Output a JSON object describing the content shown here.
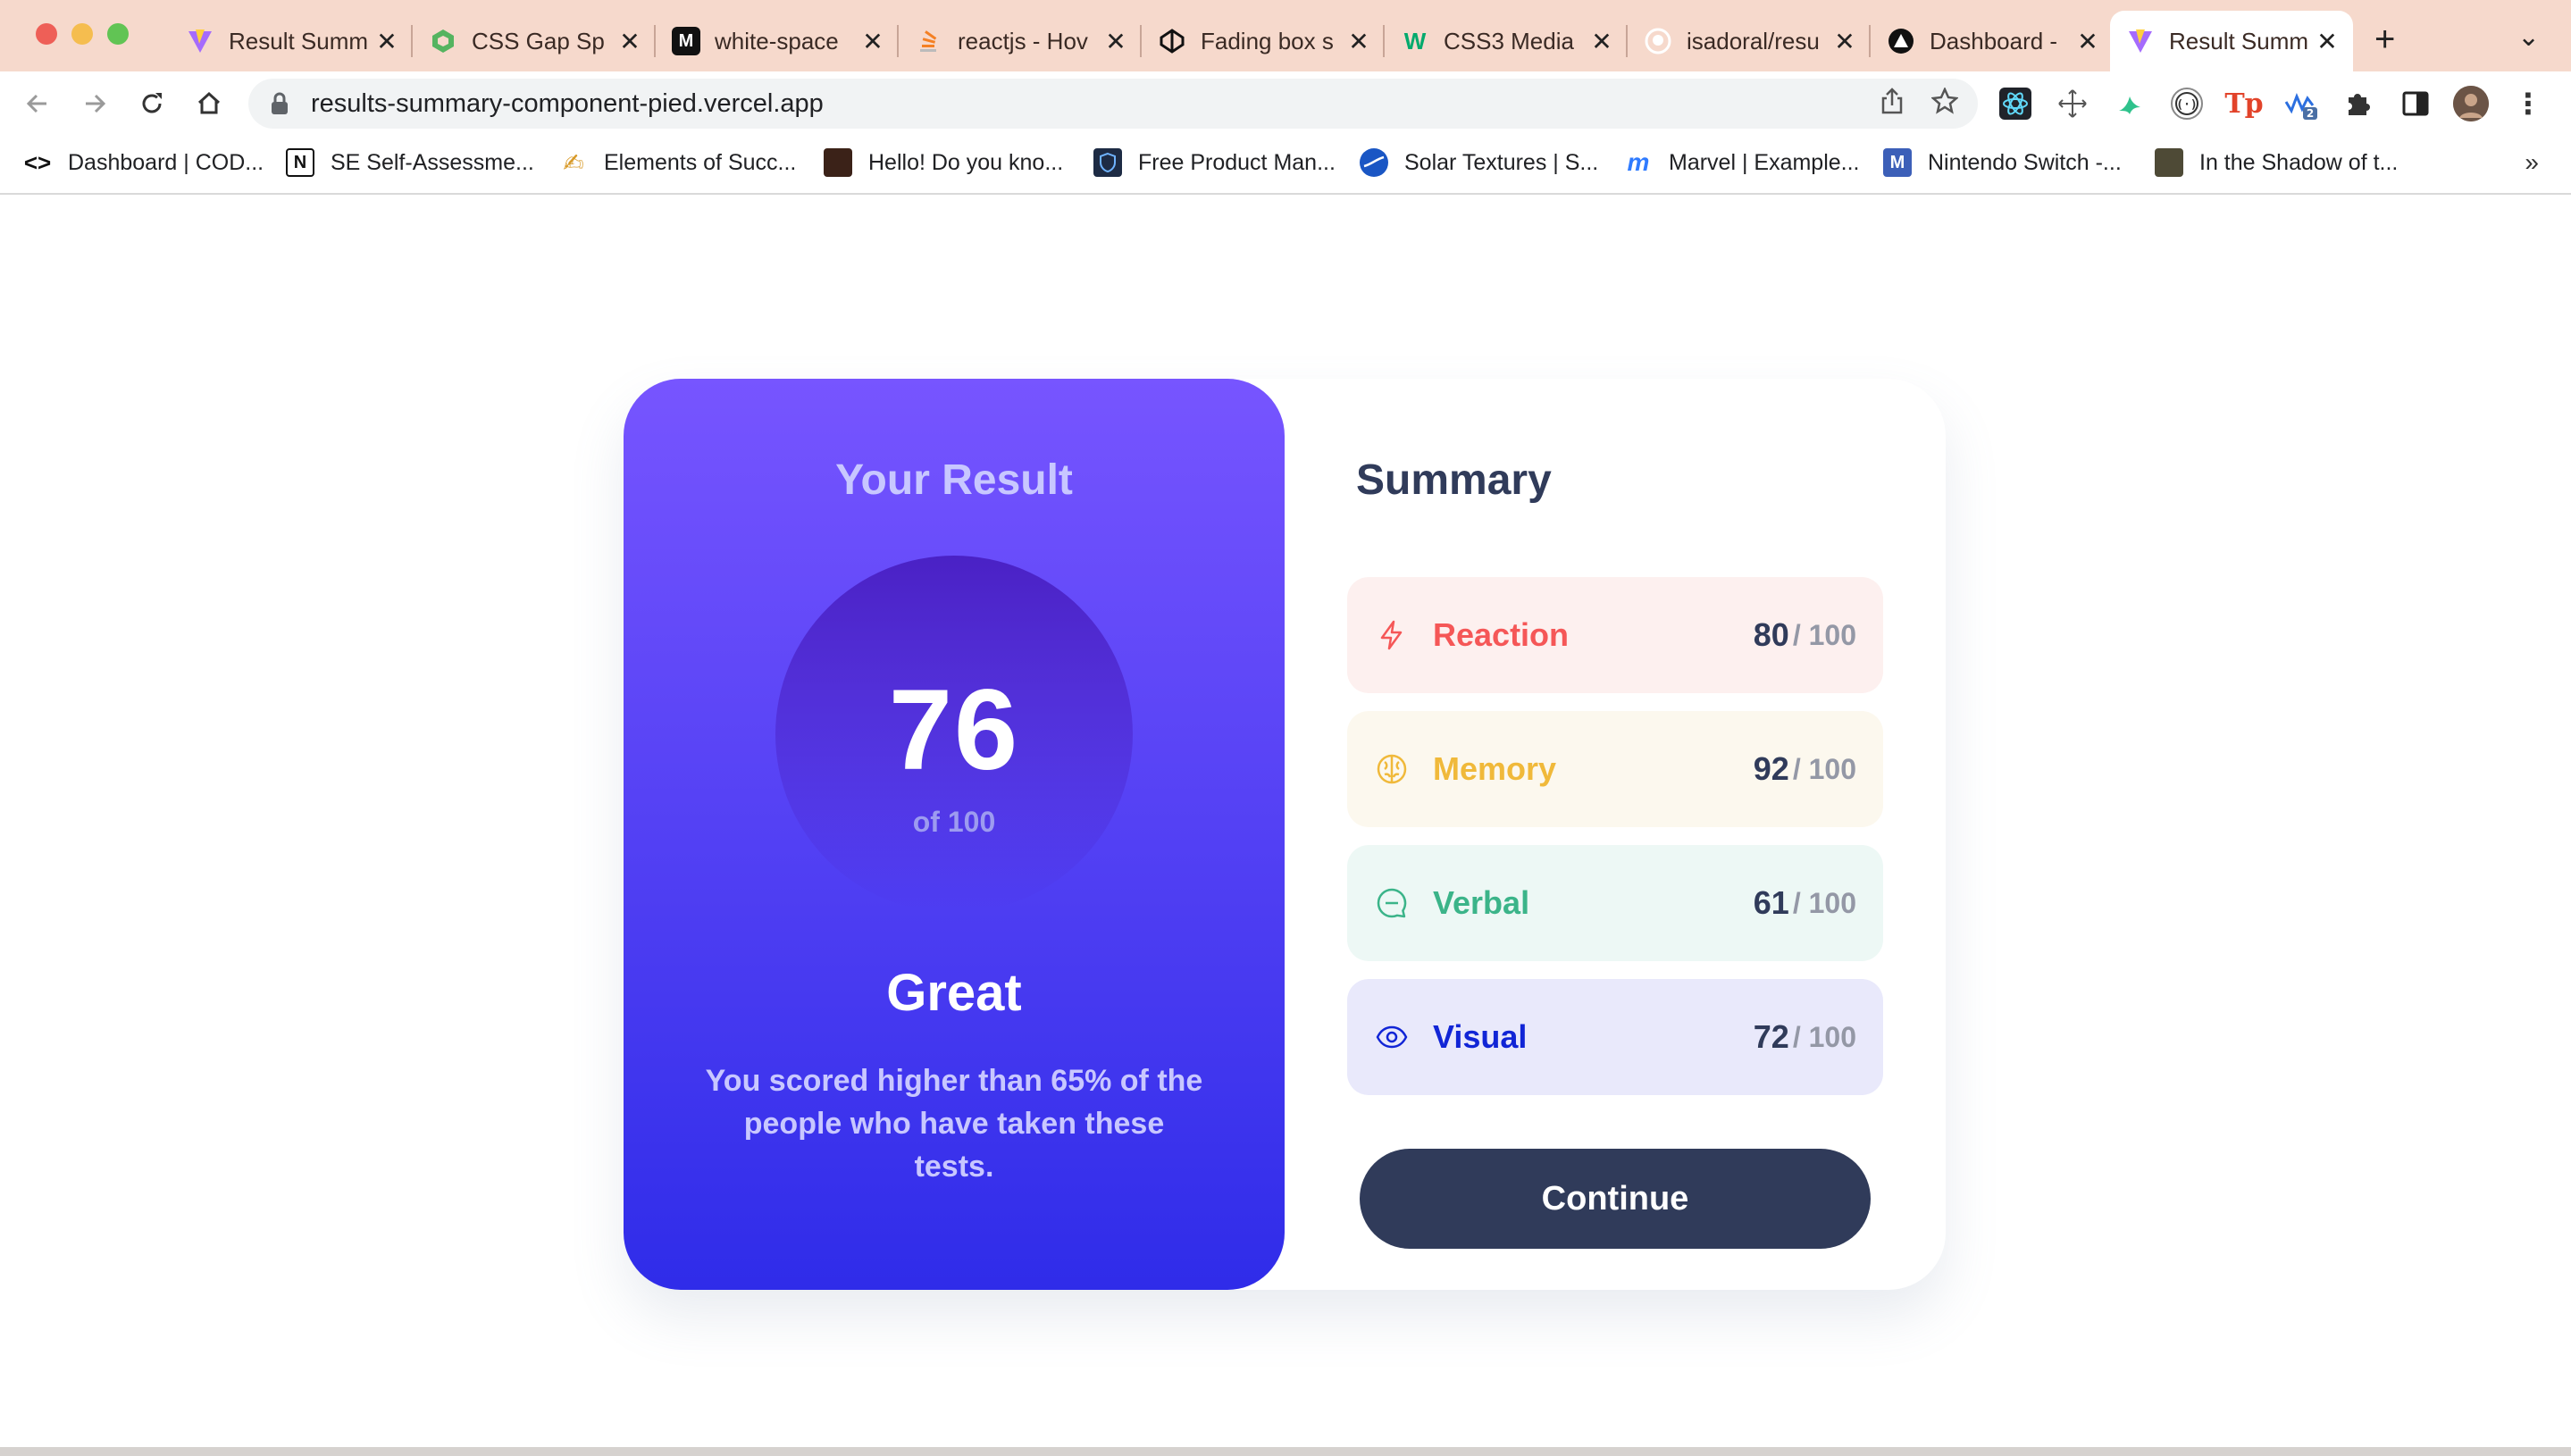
{
  "browser": {
    "tabs": [
      {
        "title": "Result Summ",
        "active": false,
        "favicon": "vite-icon"
      },
      {
        "title": "CSS Gap Sp",
        "active": false,
        "favicon": "hexagon-icon"
      },
      {
        "title": "white-space",
        "active": false,
        "favicon": "mdn-icon"
      },
      {
        "title": "reactjs - Hov",
        "active": false,
        "favicon": "stackoverflow-icon"
      },
      {
        "title": "Fading box s",
        "active": false,
        "favicon": "codepen-icon"
      },
      {
        "title": "CSS3 Media",
        "active": false,
        "favicon": "w3schools-icon"
      },
      {
        "title": "isadoral/resu",
        "active": false,
        "favicon": "github-icon"
      },
      {
        "title": "Dashboard -",
        "active": false,
        "favicon": "triangle-icon"
      },
      {
        "title": "Result Summ",
        "active": true,
        "favicon": "vite-icon"
      }
    ],
    "new_tab_label": "+",
    "url": "results-summary-component-pied.vercel.app",
    "bookmarks": [
      {
        "label": "Dashboard | COD...",
        "icon": "code-icon"
      },
      {
        "label": "SE Self-Assessme...",
        "icon": "notion-icon"
      },
      {
        "label": "Elements of Succ...",
        "icon": "pencil-icon"
      },
      {
        "label": "Hello! Do you kno...",
        "icon": "book-icon"
      },
      {
        "label": "Free Product Man...",
        "icon": "shield-icon"
      },
      {
        "label": "Solar Textures | S...",
        "icon": "planet-icon"
      },
      {
        "label": "Marvel | Example...",
        "icon": "marvel-icon"
      },
      {
        "label": "Nintendo Switch -...",
        "icon": "m-icon"
      },
      {
        "label": "In the Shadow of t...",
        "icon": "photo-icon"
      }
    ],
    "bookmarks_more": "»",
    "extension_badge": "2"
  },
  "result": {
    "heading": "Your Result",
    "score": "76",
    "score_total": "of 100",
    "grade": "Great",
    "description": "You scored higher than 65% of the people who have taken these tests."
  },
  "summary": {
    "title": "Summary",
    "categories": [
      {
        "label": "Reaction",
        "score": "80",
        "max": "/ 100",
        "color": "#f55757",
        "bg": "#fdf0ef",
        "icon": "lightning-icon"
      },
      {
        "label": "Memory",
        "score": "92",
        "max": "/ 100",
        "color": "#f0b93a",
        "bg": "#fcf8ee",
        "icon": "brain-icon"
      },
      {
        "label": "Verbal",
        "score": "61",
        "max": "/ 100",
        "color": "#3bb489",
        "bg": "#edf8f5",
        "icon": "chat-icon"
      },
      {
        "label": "Visual",
        "score": "72",
        "max": "/ 100",
        "color": "#1125d6",
        "bg": "#e9e9fb",
        "icon": "eye-icon"
      }
    ],
    "continue_label": "Continue"
  },
  "colors": {
    "gradient_top": "#7755ff",
    "gradient_bottom": "#2f2ce9",
    "button": "#303b5a",
    "tabstrip": "#f6d9cc"
  }
}
